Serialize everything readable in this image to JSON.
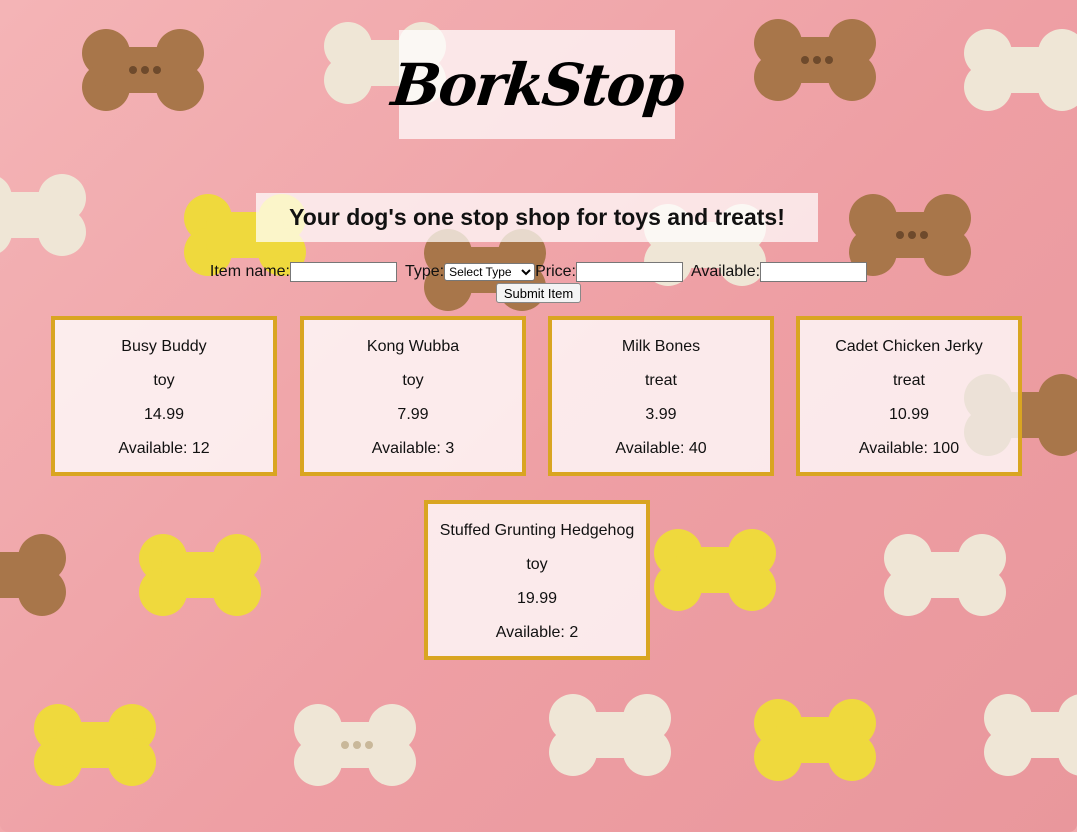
{
  "header": {
    "title": "BorkStop",
    "subtitle": "Your dog's one stop shop for toys and treats!"
  },
  "form": {
    "item_name_label": "Item name:",
    "type_label": "Type:",
    "type_selected": "Select Type",
    "price_label": "Price:",
    "available_label": "Available:",
    "submit_label": "Submit Item",
    "item_name_value": "",
    "price_value": "",
    "available_value": ""
  },
  "items": [
    {
      "name": "Busy Buddy",
      "type": "toy",
      "price": "14.99",
      "available": "Available: 12"
    },
    {
      "name": "Kong Wubba",
      "type": "toy",
      "price": "7.99",
      "available": "Available: 3"
    },
    {
      "name": "Milk Bones",
      "type": "treat",
      "price": "3.99",
      "available": "Available: 40"
    },
    {
      "name": "Cadet Chicken Jerky",
      "type": "treat",
      "price": "10.99",
      "available": "Available: 100"
    },
    {
      "name": "Stuffed Grunting Hedgehog",
      "type": "toy",
      "price": "19.99",
      "available": "Available: 2"
    }
  ],
  "colors": {
    "background": "#f2a9ac",
    "card_border": "#d9a521",
    "bone_yellow": "#f1de3e",
    "bone_cream": "#f3ead8",
    "bone_brown": "#b07b4a"
  }
}
